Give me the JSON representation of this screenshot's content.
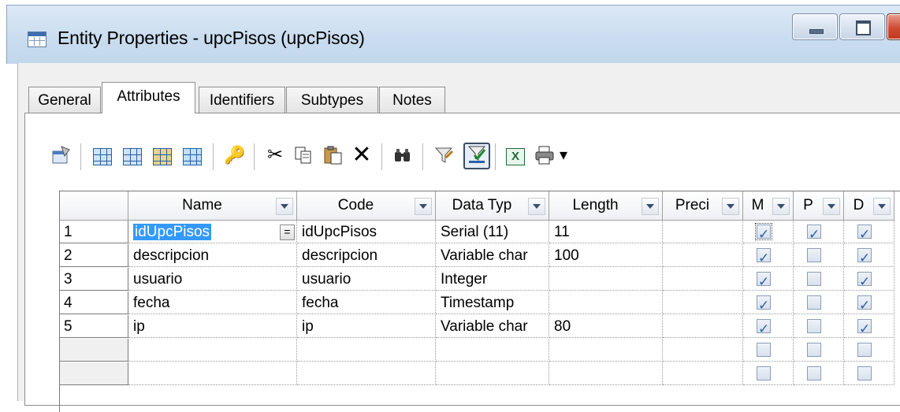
{
  "window": {
    "title": "Entity Properties - upcPisos (upcPisos)",
    "app_icon": "table-icon",
    "controls": [
      "minimize-icon",
      "maximize-icon",
      "close-icon"
    ]
  },
  "tabs": [
    {
      "label": "General",
      "active": false
    },
    {
      "label": "Attributes",
      "active": true
    },
    {
      "label": "Identifiers",
      "active": false
    },
    {
      "label": "Subtypes",
      "active": false
    },
    {
      "label": "Notes",
      "active": false
    }
  ],
  "toolbar": {
    "icons": [
      "properties-icon",
      "add-row-icon",
      "insert-row-icon",
      "add-attributes-icon",
      "reuse-attributes-icon",
      "key-icon",
      "cut-icon",
      "copy-icon",
      "paste-icon",
      "delete-icon",
      "find-icon",
      "customize-columns-icon",
      "filter-icon",
      "excel-export-icon",
      "print-icon",
      "dropdown-arrow-icon"
    ],
    "glyphs": {
      "cut": "✂",
      "delete": "✕",
      "find": "🔍",
      "excel": "X",
      "print": "🖶",
      "arrow": "▾",
      "key": "🔑",
      "filter": "⚲"
    }
  },
  "grid": {
    "columns": [
      {
        "label": "Name"
      },
      {
        "label": "Code"
      },
      {
        "label": "Data Typ"
      },
      {
        "label": "Length"
      },
      {
        "label": "Preci"
      },
      {
        "label": "M"
      },
      {
        "label": "P"
      },
      {
        "label": "D"
      }
    ],
    "rows": [
      {
        "num": "1",
        "name": "idUpcPisos",
        "equiv": "=",
        "code": "idUpcPisos",
        "type": "Serial (11)",
        "length": "11",
        "preci": "",
        "m": true,
        "p": true,
        "d": true
      },
      {
        "num": "2",
        "name": "descripcion",
        "code": "descripcion",
        "type": "Variable char",
        "length": "100",
        "preci": "",
        "m": true,
        "p": false,
        "d": true
      },
      {
        "num": "3",
        "name": "usuario",
        "code": "usuario",
        "type": "Integer",
        "length": "",
        "preci": "",
        "m": true,
        "p": false,
        "d": true
      },
      {
        "num": "4",
        "name": "fecha",
        "code": "fecha",
        "type": "Timestamp",
        "length": "",
        "preci": "",
        "m": true,
        "p": false,
        "d": true
      },
      {
        "num": "5",
        "name": "ip",
        "code": "ip",
        "type": "Variable char",
        "length": "80",
        "preci": "",
        "m": true,
        "p": false,
        "d": true
      },
      {
        "num": "",
        "name": "",
        "code": "",
        "type": "",
        "length": "",
        "preci": "",
        "m": false,
        "p": false,
        "d": false
      },
      {
        "num": "",
        "name": "",
        "code": "",
        "type": "",
        "length": "",
        "preci": "",
        "m": false,
        "p": false,
        "d": false
      }
    ]
  },
  "colors": {
    "selection": "#3399ff",
    "checkmark": "#2b5fa8",
    "titlebar": "#c9dcef"
  }
}
